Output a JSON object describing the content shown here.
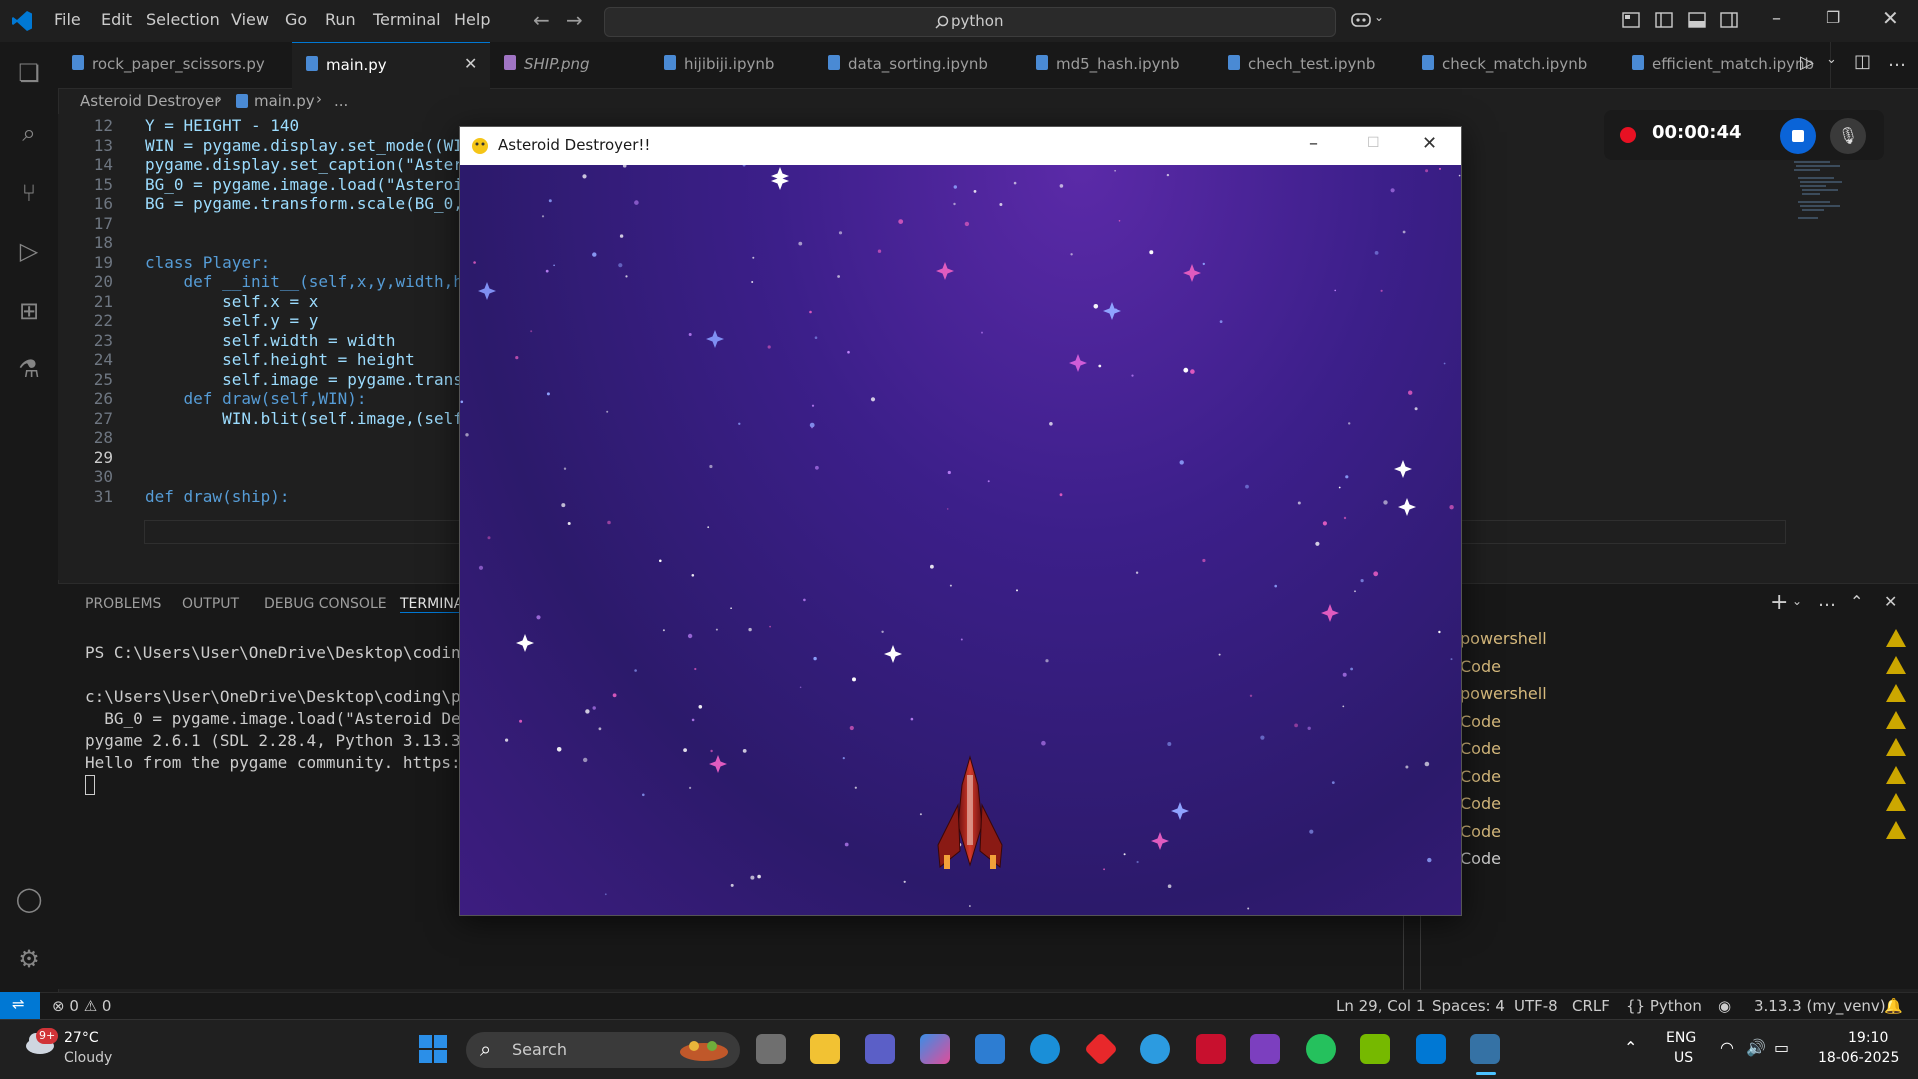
{
  "titlebar": {
    "menu": [
      "File",
      "Edit",
      "Selection",
      "View",
      "Go",
      "Run",
      "Terminal",
      "Help"
    ],
    "search_text": "python"
  },
  "tabs": [
    {
      "label": "rock_paper_scissors.py"
    },
    {
      "label": "main.py",
      "active": true
    },
    {
      "label": "SHIP.png"
    },
    {
      "label": "hijibiji.ipynb"
    },
    {
      "label": "data_sorting.ipynb"
    },
    {
      "label": "md5_hash.ipynb"
    },
    {
      "label": "chech_test.ipynb"
    },
    {
      "label": "check_match.ipynb"
    },
    {
      "label": "efficient_match.ipynb"
    }
  ],
  "breadcrumb": {
    "folder": "Asteroid Destroyer",
    "file": "main.py",
    "rest": "..."
  },
  "editor": {
    "line_numbers": [
      "12",
      "13",
      "14",
      "15",
      "16",
      "17",
      "18",
      "19",
      "20",
      "21",
      "22",
      "23",
      "24",
      "25",
      "26",
      "27",
      "28",
      "29",
      "30",
      "31"
    ],
    "lines": [
      "Y = HEIGHT - 140",
      "WIN = pygame.display.set_mode((WI",
      "pygame.display.set_caption(\"Aster",
      "BG_0 = pygame.image.load(\"Asteroi",
      "BG = pygame.transform.scale(BG_0,",
      "",
      "",
      "class Player:",
      "    def __init__(self,x,y,width,h",
      "        self.x = x",
      "        self.y = y",
      "        self.width = width",
      "        self.height = height",
      "        self.image = pygame.trans",
      "    def draw(self,WIN):",
      "        WIN.blit(self.image,(self",
      "",
      "",
      "",
      "def draw(ship):"
    ]
  },
  "panel": {
    "tabs": [
      "PROBLEMS",
      "OUTPUT",
      "DEBUG CONSOLE",
      "TERMINAL"
    ],
    "terminal_lines": [
      "PS C:\\Users\\User\\OneDrive\\Desktop\\coding\\p",
      "",
      "c:\\Users\\User\\OneDrive\\Desktop\\coding\\pyth",
      "  BG_0 = pygame.image.load(\"Asteroid Destr",
      "pygame 2.6.1 (SDL 2.28.4, Python 3.13.3)",
      "Hello from the pygame community. https://w"
    ],
    "terminal_list": [
      "powershell",
      "Code",
      "powershell",
      "Code",
      "Code",
      "Code",
      "Code",
      "Code",
      "Code"
    ]
  },
  "recorder": {
    "time": "00:00:44"
  },
  "game_window": {
    "title": "Asteroid Destroyer!!"
  },
  "statusbar": {
    "errors": "0",
    "warnings": "0",
    "position": "Ln 29, Col 1",
    "spaces": "Spaces: 4",
    "encoding": "UTF-8",
    "eol": "CRLF",
    "language": "{} Python",
    "interpreter": "3.13.3 (my_venv)"
  },
  "taskbar": {
    "weather_temp": "27°C",
    "weather_desc": "Cloudy",
    "weather_badge": "9+",
    "search": "Search",
    "lang": "ENG",
    "region": "US",
    "time": "19:10",
    "date": "18-06-2025"
  }
}
